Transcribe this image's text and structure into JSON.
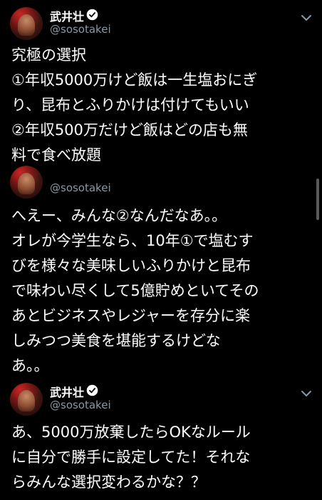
{
  "tweets": [
    {
      "name": "武井壮",
      "handle": "@sosotakei",
      "lines": [
        "究極の選択",
        "①年収5000万けど飯は一生塩おにぎ",
        "り、昆布とふりかけは付けてもいい",
        "②年収500万だけど飯はどの店も無",
        "料で食べ放題"
      ]
    },
    {
      "handle": "@sosotakei",
      "lines": [
        "へえー、みんな②なんだなあ。。",
        "オレが今学生なら、10年①で塩むす",
        "びを様々な美味しいふりかけと昆布",
        "で味わい尽くして5億貯めといてその",
        "あとビジネスやレジャーを存分に楽",
        "しみつつ美食を堪能するけどな",
        "あ。。"
      ]
    },
    {
      "name": "武井壮",
      "handle": "@sosotakei",
      "lines": [
        "あ、5000万放棄したらOKなルール",
        "に自分で勝手に設定してた！それな",
        "らみんな選択変わるかな？？"
      ]
    }
  ],
  "icons": {
    "avatar": "profile-photo",
    "verified": "verified-badge",
    "menu": "chevron-down-icon"
  },
  "colors": {
    "background": "#000000",
    "text": "#ffffff",
    "secondary": "#8899a6"
  }
}
